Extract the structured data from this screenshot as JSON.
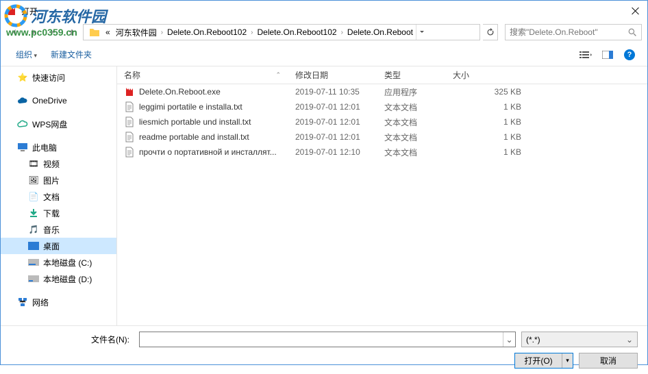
{
  "window": {
    "title": "打开"
  },
  "breadcrumb": {
    "prefix": "«",
    "items": [
      "河东软件园",
      "Delete.On.Reboot102",
      "Delete.On.Reboot102",
      "Delete.On.Reboot"
    ]
  },
  "search": {
    "placeholder": "搜索\"Delete.On.Reboot\""
  },
  "toolbar": {
    "organize": "组织",
    "newfolder": "新建文件夹"
  },
  "sidebar": {
    "quick": "快速访问",
    "onedrive": "OneDrive",
    "wps": "WPS网盘",
    "thispc": "此电脑",
    "video": "视频",
    "pictures": "图片",
    "documents": "文档",
    "downloads": "下载",
    "music": "音乐",
    "desktop": "桌面",
    "diskc": "本地磁盘 (C:)",
    "diskd": "本地磁盘 (D:)",
    "network": "网络"
  },
  "columns": {
    "name": "名称",
    "date": "修改日期",
    "type": "类型",
    "size": "大小"
  },
  "files": [
    {
      "name": "Delete.On.Reboot.exe",
      "date": "2019-07-11 10:35",
      "type": "应用程序",
      "size": "325 KB",
      "icon": "exe"
    },
    {
      "name": "leggimi portatile e installa.txt",
      "date": "2019-07-01 12:01",
      "type": "文本文档",
      "size": "1 KB",
      "icon": "txt"
    },
    {
      "name": "liesmich portable und install.txt",
      "date": "2019-07-01 12:01",
      "type": "文本文档",
      "size": "1 KB",
      "icon": "txt"
    },
    {
      "name": "readme portable and install.txt",
      "date": "2019-07-01 12:01",
      "type": "文本文档",
      "size": "1 KB",
      "icon": "txt"
    },
    {
      "name": "прочти о портативной и инсталлят...",
      "date": "2019-07-01 12:10",
      "type": "文本文档",
      "size": "1 KB",
      "icon": "txt"
    }
  ],
  "footer": {
    "filename_label": "文件名(N):",
    "filter": "(*.*)",
    "open": "打开(O)",
    "cancel": "取消"
  },
  "watermark": {
    "text": "河东软件园",
    "url": "www.pc0359.cn"
  }
}
